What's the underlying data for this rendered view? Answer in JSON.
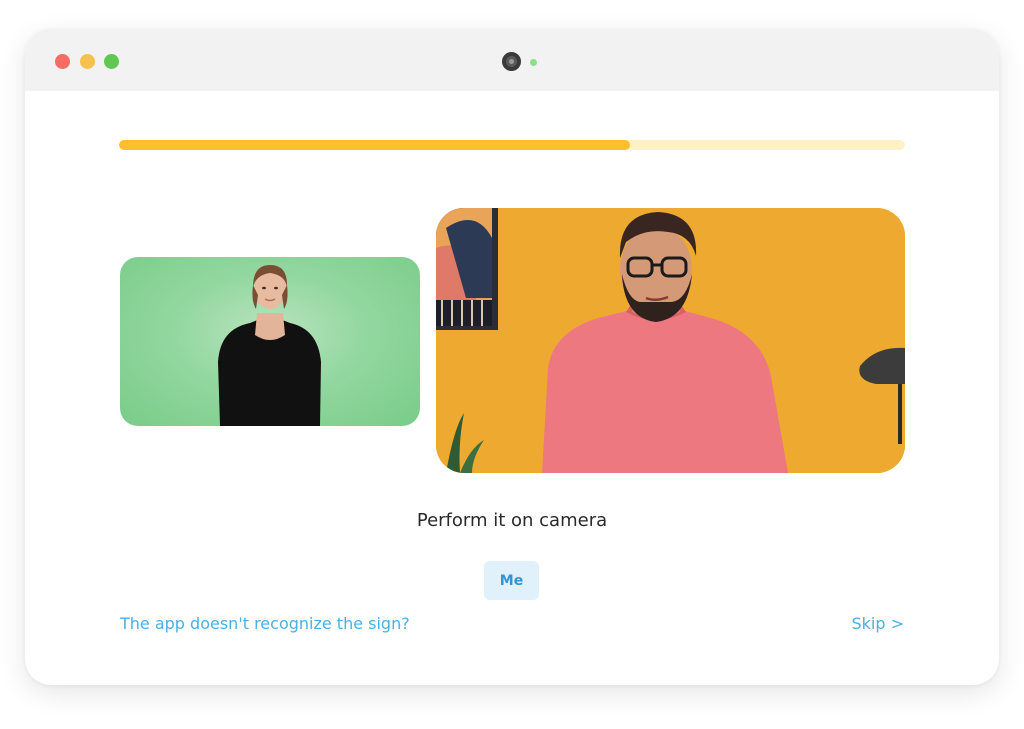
{
  "window": {
    "controls": {
      "close_color": "#f46c64",
      "minimize_color": "#f7c14f",
      "maximize_color": "#5fc852"
    },
    "camera_led_color": "#8be08a"
  },
  "progress": {
    "fraction": 0.65,
    "fill_color": "#fdbf2d",
    "track_color": "#fef1c7"
  },
  "media": {
    "sign_video_icon": "signer-video",
    "camera_feed_icon": "camera-feed"
  },
  "lesson": {
    "instruction": "Perform it on camera",
    "answer_chip": "Me"
  },
  "footer": {
    "help_link": "The app doesn't recognize the sign?",
    "skip_label": "Skip >"
  }
}
